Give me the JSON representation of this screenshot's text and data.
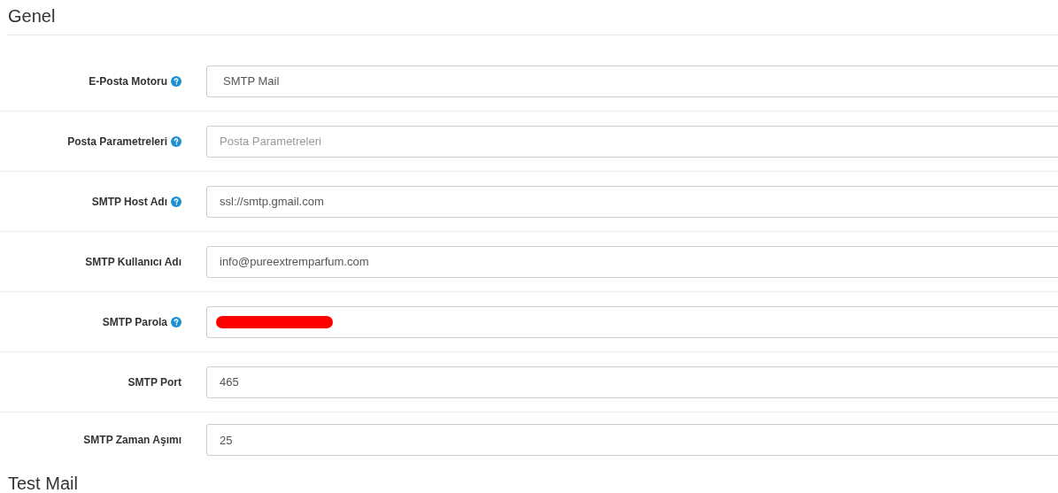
{
  "sections": [
    {
      "title": "Genel",
      "fields": [
        {
          "label": "E-Posta Motoru",
          "help": true,
          "kind": "select",
          "value": "SMTP Mail"
        },
        {
          "label": "Posta Parametreleri",
          "help": true,
          "kind": "text",
          "placeholder": "Posta Parametreleri"
        },
        {
          "label": "SMTP Host Adı",
          "help": true,
          "kind": "text",
          "value": "ssl://smtp.gmail.com"
        },
        {
          "label": "SMTP Kullanıcı Adı",
          "help": false,
          "kind": "text",
          "value": "info@pureextremparfum.com"
        },
        {
          "label": "SMTP Parola",
          "help": true,
          "kind": "redacted"
        },
        {
          "label": "SMTP Port",
          "help": false,
          "kind": "text",
          "value": "465"
        },
        {
          "label": "SMTP Zaman Aşımı",
          "help": false,
          "kind": "text",
          "value": "25"
        }
      ]
    },
    {
      "title": "Test Mail"
    }
  ]
}
